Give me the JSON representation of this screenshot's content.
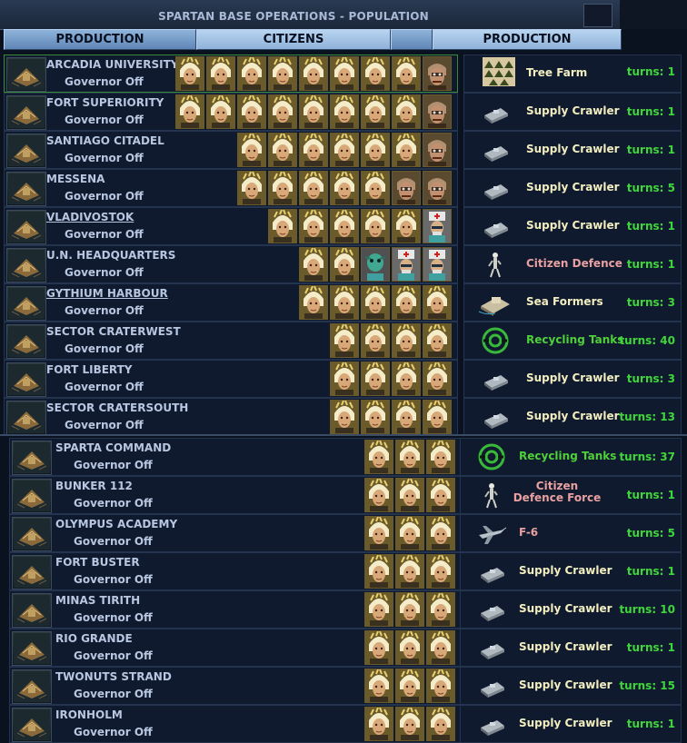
{
  "title": "SPARTAN BASE OPERATIONS - POPULATION",
  "tabs": [
    "PRODUCTION",
    "CITIZENS",
    "PRODUCTION"
  ],
  "bases": [
    {
      "name": "ARCADIA UNIVERSITY",
      "governor": "Governor Off",
      "citizens": [
        "talent",
        "talent",
        "talent",
        "talent",
        "talent",
        "talent",
        "talent",
        "talent",
        "drone"
      ],
      "prod": "Tree Farm",
      "prod_icon": "tree-farm-icon",
      "turns": "turns:  1",
      "color": "normal"
    },
    {
      "name": "FORT SUPERIORITY",
      "governor": "Governor Off",
      "citizens": [
        "talent",
        "talent",
        "talent",
        "talent",
        "talent",
        "talent",
        "talent",
        "talent",
        "drone"
      ],
      "prod": "Supply Crawler",
      "prod_icon": "supply-crawler-icon",
      "turns": "turns:  1",
      "color": "normal"
    },
    {
      "name": "SANTIAGO CITADEL",
      "governor": "Governor Off",
      "citizens": [
        "talent",
        "talent",
        "talent",
        "talent",
        "talent",
        "talent",
        "drone"
      ],
      "prod": "Supply Crawler",
      "prod_icon": "supply-crawler-icon",
      "turns": "turns:  1",
      "color": "normal"
    },
    {
      "name": "MESSENA",
      "governor": "Governor Off",
      "citizens": [
        "talent",
        "talent",
        "talent",
        "talent",
        "talent",
        "drone",
        "drone"
      ],
      "prod": "Supply Crawler",
      "prod_icon": "supply-crawler-icon",
      "turns": "turns:  5",
      "color": "normal"
    },
    {
      "name": "VLADIVOSTOK",
      "governor": "Governor Off",
      "citizens": [
        "talent",
        "talent",
        "talent",
        "talent",
        "talent",
        "doctor"
      ],
      "prod": "Supply Crawler",
      "prod_icon": "supply-crawler-icon",
      "turns": "turns:  1",
      "color": "normal",
      "underline": true
    },
    {
      "name": "U.N. HEADQUARTERS",
      "governor": "Governor Off",
      "citizens": [
        "talent",
        "talent",
        "alien",
        "doctor",
        "doctor"
      ],
      "prod": "Citizen Defence Fo",
      "prod_icon": "citizen-defence-icon",
      "turns": "turns:  1",
      "color": "pink"
    },
    {
      "name": "GYTHIUM HARBOUR",
      "governor": "Governor Off",
      "citizens": [
        "talent",
        "talent",
        "talent",
        "talent",
        "talent"
      ],
      "prod": "Sea Formers",
      "prod_icon": "sea-formers-icon",
      "turns": "turns:  3",
      "color": "normal",
      "underline": true
    },
    {
      "name": "SECTOR CRATERWEST",
      "governor": "Governor Off",
      "citizens": [
        "talent",
        "talent",
        "talent",
        "talent"
      ],
      "prod": "Recycling Tanks",
      "prod_icon": "recycling-tanks-icon",
      "turns": "turns:  40",
      "color": "green"
    },
    {
      "name": "FORT LIBERTY",
      "governor": "Governor Off",
      "citizens": [
        "talent",
        "talent",
        "talent",
        "talent"
      ],
      "prod": "Supply Crawler",
      "prod_icon": "supply-crawler-icon",
      "turns": "turns:  3",
      "color": "normal"
    },
    {
      "name": "SECTOR CRATERSOUTH",
      "governor": "Governor Off",
      "citizens": [
        "talent",
        "talent",
        "talent",
        "talent"
      ],
      "prod": "Supply Crawler",
      "prod_icon": "supply-crawler-icon",
      "turns": "turns:  13",
      "color": "normal"
    },
    {
      "name": "SPARTA COMMAND",
      "governor": "Governor Off",
      "citizens": [
        "talent",
        "talent",
        "talent"
      ],
      "prod": "Recycling Tanks",
      "prod_icon": "recycling-tanks-icon",
      "turns": "turns:  37",
      "color": "green"
    },
    {
      "name": "BUNKER 112",
      "governor": "Governor Off",
      "citizens": [
        "talent",
        "talent",
        "talent"
      ],
      "prod": "Citizen Defence Force",
      "prod_icon": "citizen-defence-icon",
      "turns": "turns:  1",
      "color": "pink",
      "twoline": true
    },
    {
      "name": "OLYMPUS ACADEMY",
      "governor": "Governor Off",
      "citizens": [
        "talent",
        "talent",
        "talent"
      ],
      "prod": "F-6",
      "prod_icon": "f6-icon",
      "turns": "turns:  5",
      "color": "pink"
    },
    {
      "name": "FORT BUSTER",
      "governor": "Governor Off",
      "citizens": [
        "talent",
        "talent",
        "talent"
      ],
      "prod": "Supply Crawler",
      "prod_icon": "supply-crawler-icon",
      "turns": "turns:  1",
      "color": "normal"
    },
    {
      "name": "MINAS TIRITH",
      "governor": "Governor Off",
      "citizens": [
        "talent",
        "talent",
        "talent"
      ],
      "prod": "Supply Crawler",
      "prod_icon": "supply-crawler-icon",
      "turns": "turns:  10",
      "color": "normal"
    },
    {
      "name": "RIO GRANDE",
      "governor": "Governor Off",
      "citizens": [
        "talent",
        "talent",
        "talent"
      ],
      "prod": "Supply Crawler",
      "prod_icon": "supply-crawler-icon",
      "turns": "turns:  1",
      "color": "normal"
    },
    {
      "name": "TWONUTS STRAND",
      "governor": "Governor Off",
      "citizens": [
        "talent",
        "talent",
        "talent"
      ],
      "prod": "Supply Crawler",
      "prod_icon": "supply-crawler-icon",
      "turns": "turns:  15",
      "color": "normal"
    },
    {
      "name": "IRONHOLM",
      "governor": "Governor Off",
      "citizens": [
        "talent",
        "talent",
        "talent"
      ],
      "prod": "Supply Crawler",
      "prod_icon": "supply-crawler-icon",
      "turns": "turns:  1",
      "color": "normal"
    }
  ]
}
